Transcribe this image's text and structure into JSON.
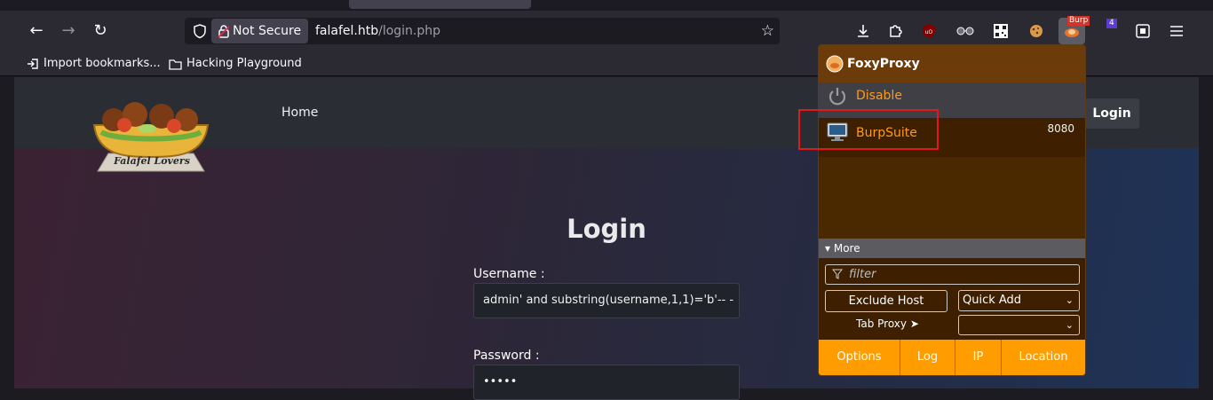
{
  "browser": {
    "security_label": "Not Secure",
    "url_host": "falafel.htb",
    "url_path": "/login.php",
    "bookmarks": [
      {
        "label": "Import bookmarks..."
      },
      {
        "label": "Hacking Playground"
      }
    ],
    "extensions": {
      "burp_badge": "Burp",
      "count_badge": "4"
    }
  },
  "site": {
    "logo_text": "Falafel Lovers",
    "nav_home": "Home",
    "nav_login": "Login",
    "title": "Login",
    "username_label": "Username :",
    "username_value": "admin' and substring(username,1,1)='b'-- -",
    "password_label": "Password :",
    "password_value": "•••••"
  },
  "foxyproxy": {
    "title": "FoxyProxy",
    "disable_label": "Disable",
    "proxy_name": "BurpSuite",
    "proxy_port": "8080",
    "more_label": "▾ More",
    "filter_placeholder": "filter",
    "exclude_host": "Exclude Host",
    "quick_add": "Quick Add",
    "tab_proxy": "Tab Proxy ➤",
    "tab_proxy_value": "",
    "footer": [
      "Options",
      "Log",
      "IP",
      "Location"
    ],
    "colors": {
      "accent": "#ff9d00",
      "text": "#ff9a1a",
      "background": "#3e2000"
    }
  }
}
